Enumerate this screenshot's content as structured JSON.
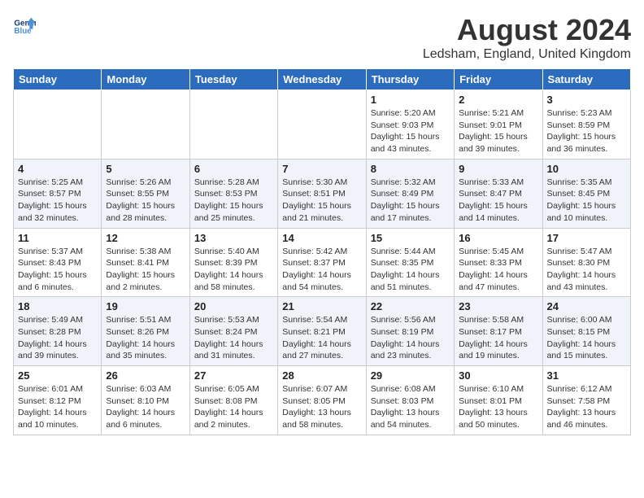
{
  "header": {
    "logo_line1": "General",
    "logo_line2": "Blue",
    "month_year": "August 2024",
    "location": "Ledsham, England, United Kingdom"
  },
  "weekdays": [
    "Sunday",
    "Monday",
    "Tuesday",
    "Wednesday",
    "Thursday",
    "Friday",
    "Saturday"
  ],
  "weeks": [
    [
      {
        "day": "",
        "info": ""
      },
      {
        "day": "",
        "info": ""
      },
      {
        "day": "",
        "info": ""
      },
      {
        "day": "",
        "info": ""
      },
      {
        "day": "1",
        "info": "Sunrise: 5:20 AM\nSunset: 9:03 PM\nDaylight: 15 hours\nand 43 minutes."
      },
      {
        "day": "2",
        "info": "Sunrise: 5:21 AM\nSunset: 9:01 PM\nDaylight: 15 hours\nand 39 minutes."
      },
      {
        "day": "3",
        "info": "Sunrise: 5:23 AM\nSunset: 8:59 PM\nDaylight: 15 hours\nand 36 minutes."
      }
    ],
    [
      {
        "day": "4",
        "info": "Sunrise: 5:25 AM\nSunset: 8:57 PM\nDaylight: 15 hours\nand 32 minutes."
      },
      {
        "day": "5",
        "info": "Sunrise: 5:26 AM\nSunset: 8:55 PM\nDaylight: 15 hours\nand 28 minutes."
      },
      {
        "day": "6",
        "info": "Sunrise: 5:28 AM\nSunset: 8:53 PM\nDaylight: 15 hours\nand 25 minutes."
      },
      {
        "day": "7",
        "info": "Sunrise: 5:30 AM\nSunset: 8:51 PM\nDaylight: 15 hours\nand 21 minutes."
      },
      {
        "day": "8",
        "info": "Sunrise: 5:32 AM\nSunset: 8:49 PM\nDaylight: 15 hours\nand 17 minutes."
      },
      {
        "day": "9",
        "info": "Sunrise: 5:33 AM\nSunset: 8:47 PM\nDaylight: 15 hours\nand 14 minutes."
      },
      {
        "day": "10",
        "info": "Sunrise: 5:35 AM\nSunset: 8:45 PM\nDaylight: 15 hours\nand 10 minutes."
      }
    ],
    [
      {
        "day": "11",
        "info": "Sunrise: 5:37 AM\nSunset: 8:43 PM\nDaylight: 15 hours\nand 6 minutes."
      },
      {
        "day": "12",
        "info": "Sunrise: 5:38 AM\nSunset: 8:41 PM\nDaylight: 15 hours\nand 2 minutes."
      },
      {
        "day": "13",
        "info": "Sunrise: 5:40 AM\nSunset: 8:39 PM\nDaylight: 14 hours\nand 58 minutes."
      },
      {
        "day": "14",
        "info": "Sunrise: 5:42 AM\nSunset: 8:37 PM\nDaylight: 14 hours\nand 54 minutes."
      },
      {
        "day": "15",
        "info": "Sunrise: 5:44 AM\nSunset: 8:35 PM\nDaylight: 14 hours\nand 51 minutes."
      },
      {
        "day": "16",
        "info": "Sunrise: 5:45 AM\nSunset: 8:33 PM\nDaylight: 14 hours\nand 47 minutes."
      },
      {
        "day": "17",
        "info": "Sunrise: 5:47 AM\nSunset: 8:30 PM\nDaylight: 14 hours\nand 43 minutes."
      }
    ],
    [
      {
        "day": "18",
        "info": "Sunrise: 5:49 AM\nSunset: 8:28 PM\nDaylight: 14 hours\nand 39 minutes."
      },
      {
        "day": "19",
        "info": "Sunrise: 5:51 AM\nSunset: 8:26 PM\nDaylight: 14 hours\nand 35 minutes."
      },
      {
        "day": "20",
        "info": "Sunrise: 5:53 AM\nSunset: 8:24 PM\nDaylight: 14 hours\nand 31 minutes."
      },
      {
        "day": "21",
        "info": "Sunrise: 5:54 AM\nSunset: 8:21 PM\nDaylight: 14 hours\nand 27 minutes."
      },
      {
        "day": "22",
        "info": "Sunrise: 5:56 AM\nSunset: 8:19 PM\nDaylight: 14 hours\nand 23 minutes."
      },
      {
        "day": "23",
        "info": "Sunrise: 5:58 AM\nSunset: 8:17 PM\nDaylight: 14 hours\nand 19 minutes."
      },
      {
        "day": "24",
        "info": "Sunrise: 6:00 AM\nSunset: 8:15 PM\nDaylight: 14 hours\nand 15 minutes."
      }
    ],
    [
      {
        "day": "25",
        "info": "Sunrise: 6:01 AM\nSunset: 8:12 PM\nDaylight: 14 hours\nand 10 minutes."
      },
      {
        "day": "26",
        "info": "Sunrise: 6:03 AM\nSunset: 8:10 PM\nDaylight: 14 hours\nand 6 minutes."
      },
      {
        "day": "27",
        "info": "Sunrise: 6:05 AM\nSunset: 8:08 PM\nDaylight: 14 hours\nand 2 minutes."
      },
      {
        "day": "28",
        "info": "Sunrise: 6:07 AM\nSunset: 8:05 PM\nDaylight: 13 hours\nand 58 minutes."
      },
      {
        "day": "29",
        "info": "Sunrise: 6:08 AM\nSunset: 8:03 PM\nDaylight: 13 hours\nand 54 minutes."
      },
      {
        "day": "30",
        "info": "Sunrise: 6:10 AM\nSunset: 8:01 PM\nDaylight: 13 hours\nand 50 minutes."
      },
      {
        "day": "31",
        "info": "Sunrise: 6:12 AM\nSunset: 7:58 PM\nDaylight: 13 hours\nand 46 minutes."
      }
    ]
  ]
}
